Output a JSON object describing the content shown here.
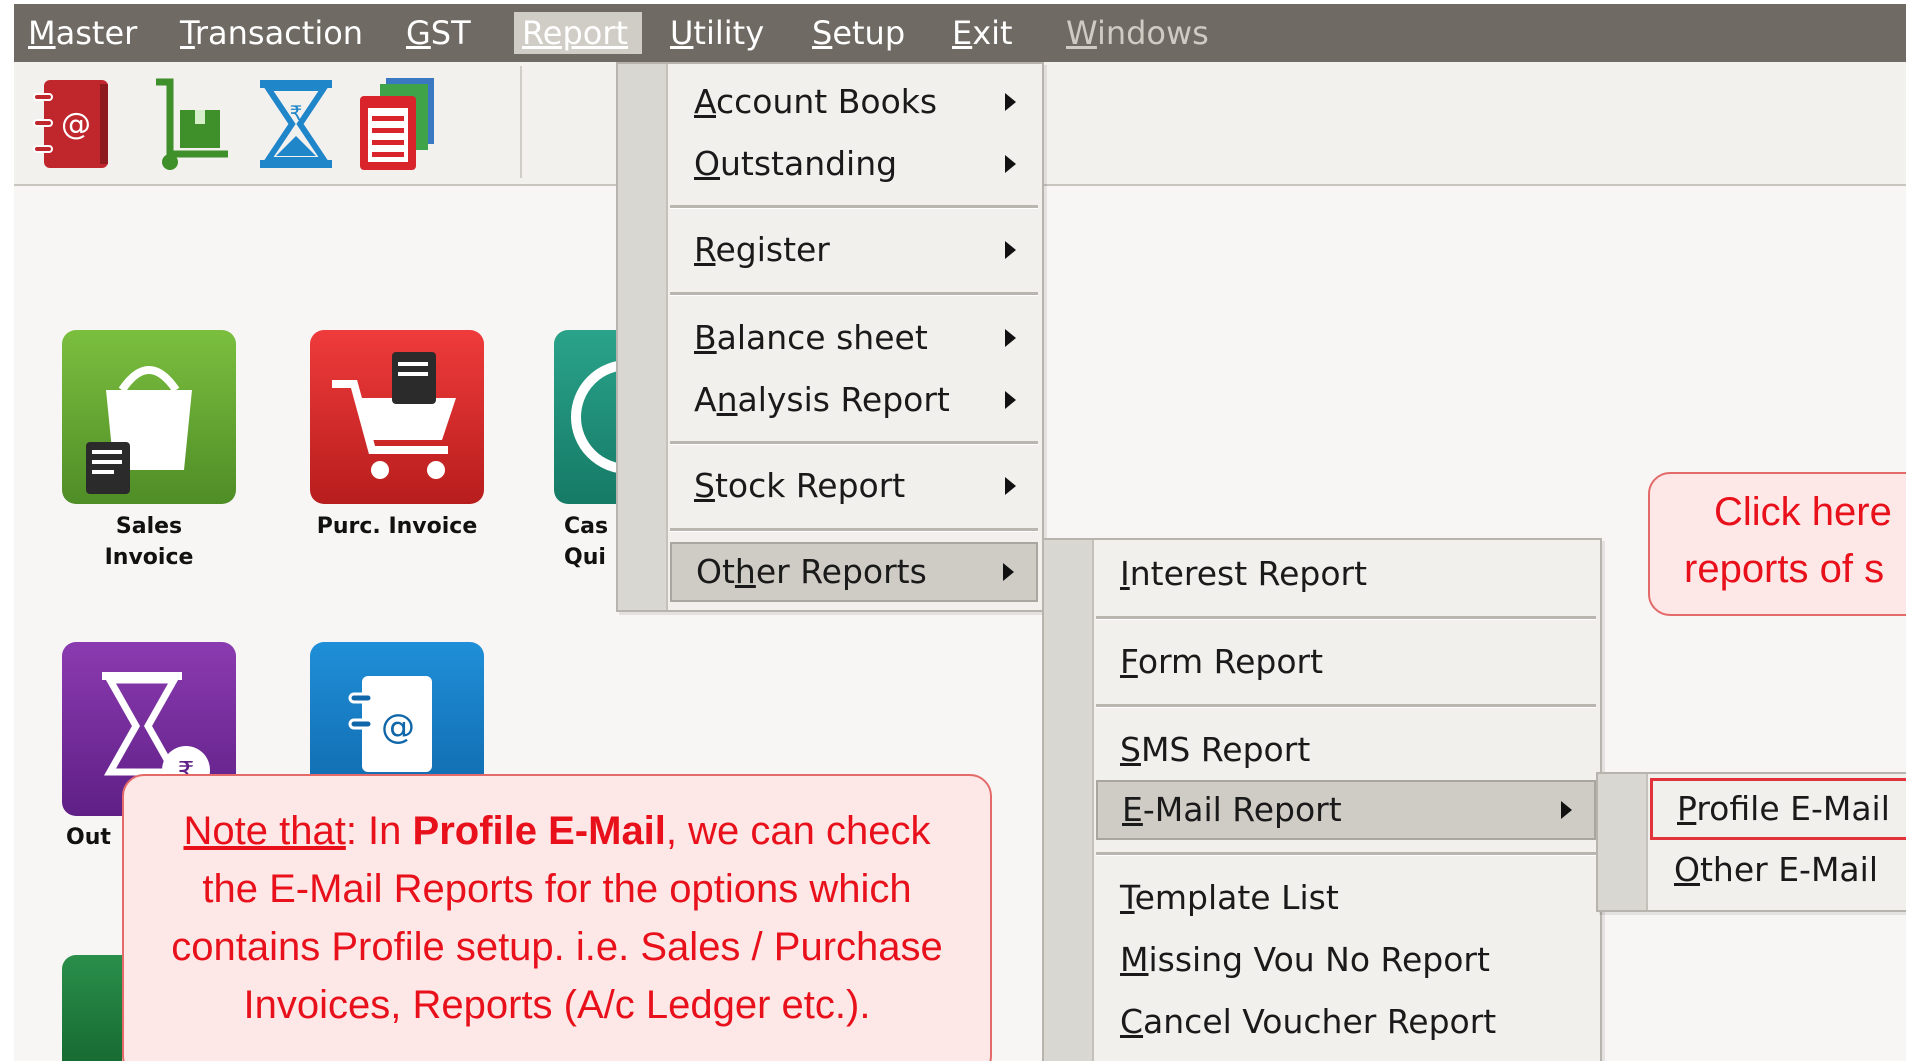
{
  "menubar": {
    "items": [
      {
        "key": "M",
        "rest": "aster"
      },
      {
        "key": "T",
        "rest": "ransaction"
      },
      {
        "key": "G",
        "rest": "ST"
      },
      {
        "key": "R",
        "rest": "eport"
      },
      {
        "key": "U",
        "rest": "tility"
      },
      {
        "key": "S",
        "rest": "etup"
      },
      {
        "key": "E",
        "rest": "xit"
      },
      {
        "key": "W",
        "rest": "indows"
      }
    ]
  },
  "toolbar": {
    "icons": [
      "address-book-icon",
      "delivery-trolley-icon",
      "hourglass-rupee-icon",
      "documents-stack-icon"
    ]
  },
  "tiles": {
    "sales_line1": "Sales",
    "sales_line2": "Invoice",
    "purc_line1": "Purc. Invoice",
    "cash_line1": "Cas",
    "cash_line2": "Qui",
    "out_line1": "Out"
  },
  "report_menu": {
    "items": [
      {
        "pre": "",
        "key": "A",
        "post": "ccount Books"
      },
      {
        "pre": "",
        "key": "O",
        "post": "utstanding"
      },
      {
        "pre": "",
        "key": "R",
        "post": "egister"
      },
      {
        "pre": "",
        "key": "B",
        "post": "alance sheet"
      },
      {
        "pre": "A",
        "key": "n",
        "post": "alysis Report"
      },
      {
        "pre": "",
        "key": "S",
        "post": "tock Report"
      },
      {
        "pre": "Ot",
        "key": "h",
        "post": "er Reports"
      }
    ]
  },
  "other_reports_menu": {
    "items": [
      {
        "pre": "",
        "key": "I",
        "post": "nterest Report"
      },
      {
        "pre": "",
        "key": "F",
        "post": "orm Report"
      },
      {
        "pre": "",
        "key": "S",
        "post": "MS Report"
      },
      {
        "pre": "",
        "key": "E",
        "post": "-Mail Report"
      },
      {
        "pre": "",
        "key": "T",
        "post": "emplate List"
      },
      {
        "pre": "",
        "key": "M",
        "post": "issing Vou No Report"
      },
      {
        "pre": "",
        "key": "C",
        "post": "ancel Voucher Report"
      }
    ]
  },
  "email_menu": {
    "items": [
      {
        "pre": "",
        "key": "P",
        "post": "rofile E-Mail"
      },
      {
        "pre": "",
        "key": "O",
        "post": "ther E-Mail"
      }
    ]
  },
  "callout_right": {
    "line1": "Click here",
    "line2": "reports of s"
  },
  "callout_note": {
    "label": "Note that",
    "after_label": ": In ",
    "bold": "Profile E-Mail",
    "rest1": ", we can check",
    "line2": "the E-Mail Reports for the options which",
    "line3": "contains Profile setup. i.e. Sales / Purchase",
    "line4": "Invoices, Reports (A/c Ledger etc.)."
  },
  "colors": {
    "menubar": "#6f6a63",
    "callout_text": "#e8101a",
    "callout_bg": "#fde7e7",
    "highlight_box": "#e0343a"
  }
}
